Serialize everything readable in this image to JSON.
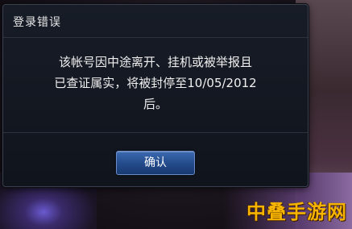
{
  "dialog": {
    "title": "登录错误",
    "message_line1": "该帐号因中途离开、挂机或被举报且",
    "message_line2": "已查证属实，将被封停至10/05/2012",
    "message_line3": "后。",
    "confirm_label": "确认"
  },
  "watermark": "中叠手游网"
}
